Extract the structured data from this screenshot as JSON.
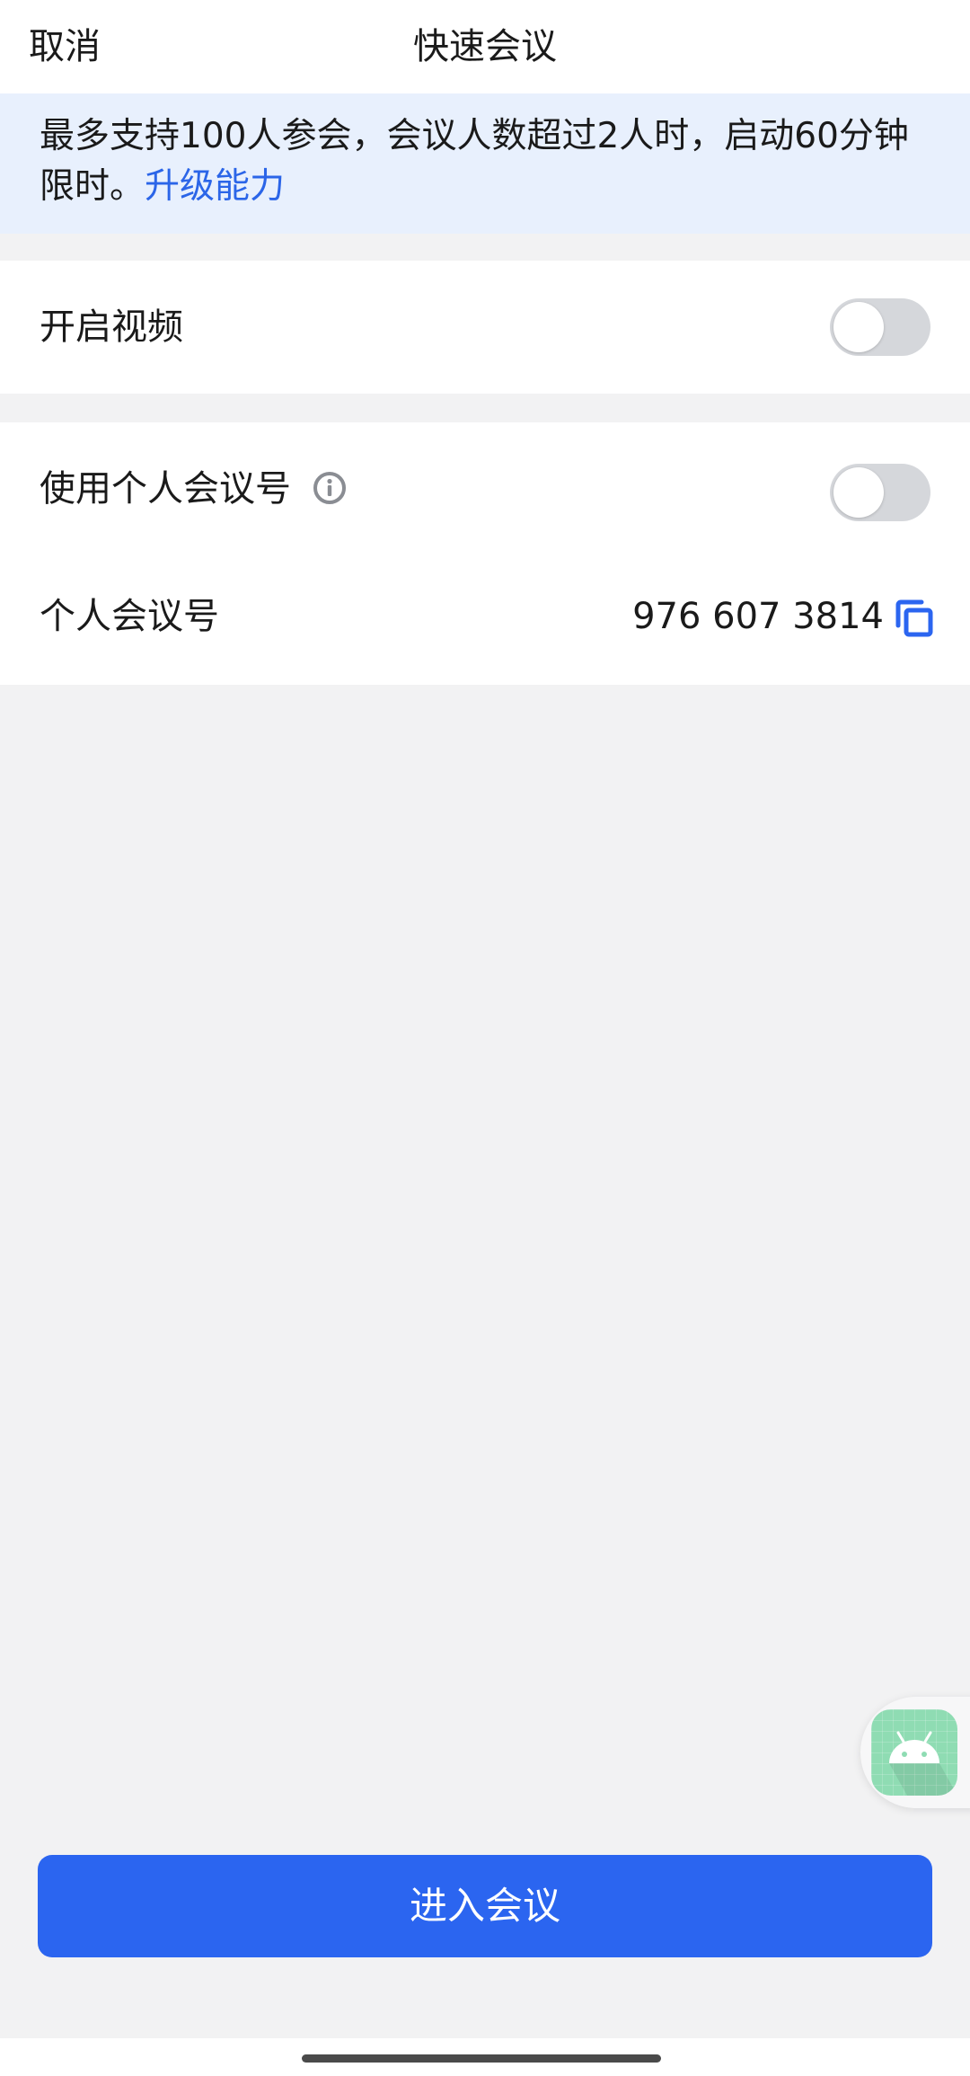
{
  "header": {
    "cancel_label": "取消",
    "title": "快速会议"
  },
  "notice": {
    "text": "最多支持100人参会，会议人数超过2人时，启动60分钟限时。",
    "link_label": "升级能力"
  },
  "settings": {
    "video": {
      "label": "开启视频",
      "enabled": false
    },
    "use_pmi": {
      "label": "使用个人会议号",
      "enabled": false,
      "info_icon": "info-icon"
    },
    "pmi": {
      "label": "个人会议号",
      "number": "976 607 3814",
      "copy_icon": "copy-icon"
    }
  },
  "floating_button": {
    "icon": "android-icon"
  },
  "footer": {
    "enter_label": "进入会议"
  },
  "colors": {
    "accent": "#2b65f0",
    "link": "#2b65e8",
    "notice_bg": "#e8f0fd",
    "toggle_off": "#d5d7db"
  }
}
